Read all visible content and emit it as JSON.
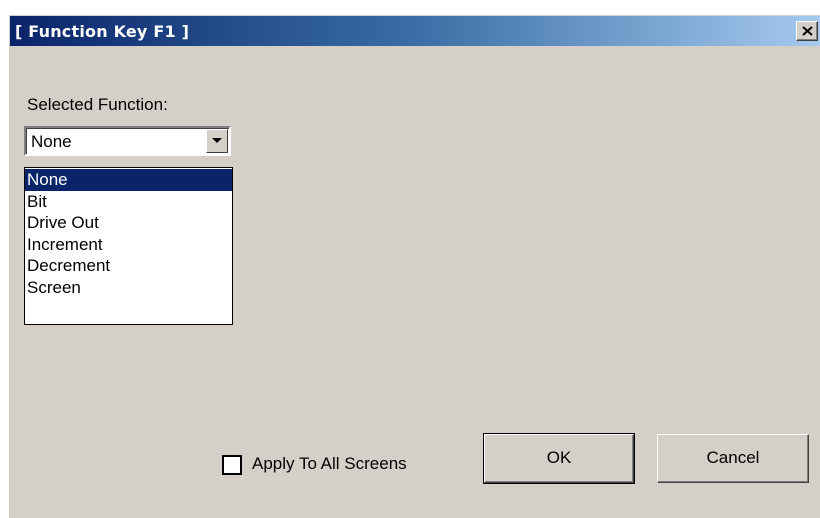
{
  "window": {
    "title": "[ Function Key F1 ]",
    "close_icon": "close-x-icon"
  },
  "form": {
    "selected_function_label": "Selected Function:",
    "selected_function_value": "None",
    "dropdown_arrow_icon": "chevron-down-icon",
    "options": [
      {
        "label": "None",
        "selected": true
      },
      {
        "label": "Bit",
        "selected": false
      },
      {
        "label": "Drive Out",
        "selected": false
      },
      {
        "label": "Increment",
        "selected": false
      },
      {
        "label": "Decrement",
        "selected": false
      },
      {
        "label": "Screen",
        "selected": false
      }
    ]
  },
  "footer": {
    "apply_all_label": "Apply To All Screens",
    "apply_all_checked": false,
    "ok_label": "OK",
    "cancel_label": "Cancel"
  },
  "colors": {
    "titlebar_start": "#0a246a",
    "titlebar_end": "#a6caf0",
    "dialog_bg": "#d4d0c8",
    "selection_bg": "#0a246a"
  }
}
